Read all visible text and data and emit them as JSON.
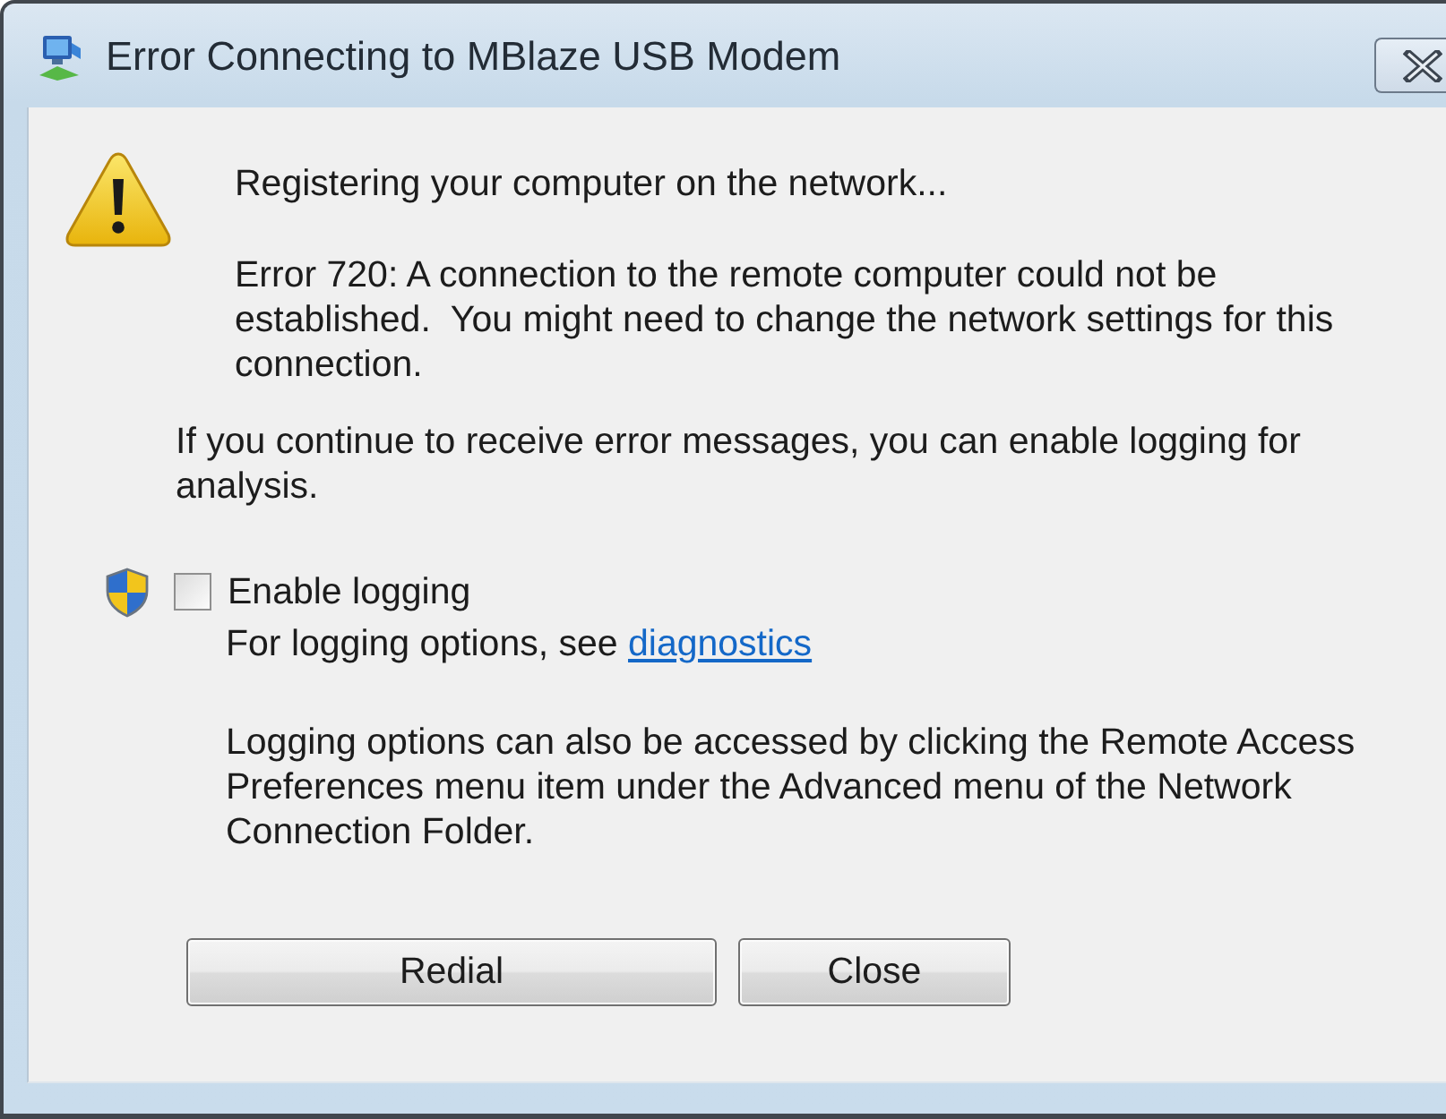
{
  "window": {
    "title": "Error Connecting to MBlaze USB Modem"
  },
  "message": {
    "status": "Registering your computer on the network...",
    "error": "Error 720: A connection to the remote computer could not be established.  You might need to change the network settings for this connection."
  },
  "hint": "If you continue to receive error messages, you can enable logging for analysis.",
  "logging": {
    "label": "Enable logging",
    "checked": false,
    "options_text": "For logging options, see",
    "link": "diagnostics",
    "note": "Logging options can also be accessed by clicking the Remote Access Preferences menu item under the Advanced menu of the Network Connection Folder."
  },
  "buttons": [
    {
      "label": "Redial"
    },
    {
      "label": "Close"
    }
  ]
}
